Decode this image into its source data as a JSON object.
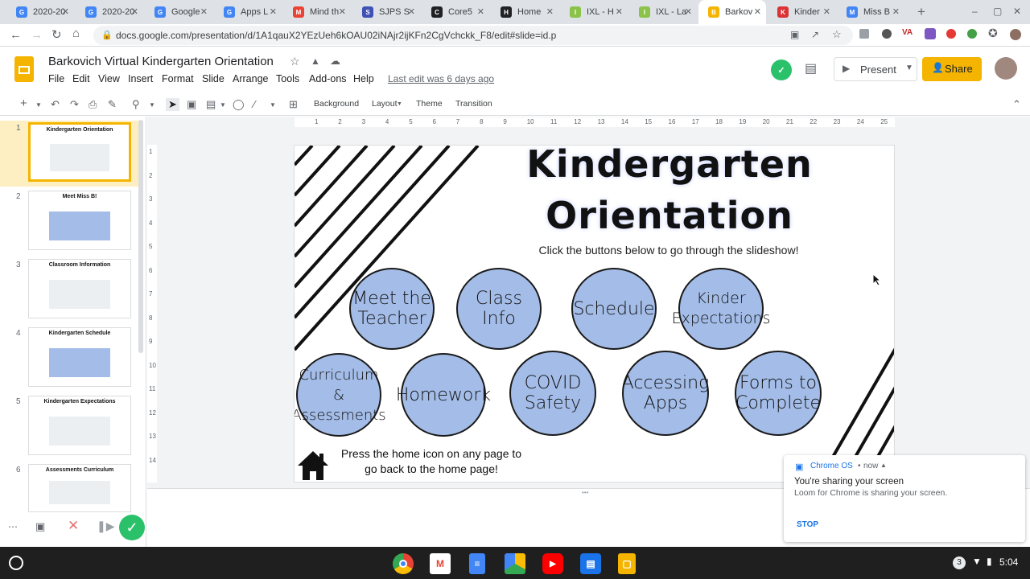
{
  "browser": {
    "tabs": [
      {
        "label": "2020-20",
        "color": "#4285f4",
        "glyph": "G"
      },
      {
        "label": "2020-20",
        "color": "#4285f4",
        "glyph": "G"
      },
      {
        "label": "Google",
        "color": "#4285f4",
        "glyph": "G"
      },
      {
        "label": "Apps L",
        "color": "#4285f4",
        "glyph": "G"
      },
      {
        "label": "Mind th",
        "color": "#ea4335",
        "glyph": "M"
      },
      {
        "label": "SJPS S",
        "color": "#3f51b5",
        "glyph": "S"
      },
      {
        "label": "Core5",
        "color": "#202124",
        "glyph": "C"
      },
      {
        "label": "Home",
        "color": "#202124",
        "glyph": "H"
      },
      {
        "label": "IXL - H",
        "color": "#8bc34a",
        "glyph": "I"
      },
      {
        "label": "IXL - La",
        "color": "#8bc34a",
        "glyph": "I"
      },
      {
        "label": "Barkov",
        "color": "#f4b400",
        "glyph": "B"
      },
      {
        "label": "Kinder",
        "color": "#db3236",
        "glyph": "K"
      },
      {
        "label": "Miss B",
        "color": "#4285f4",
        "glyph": "M"
      }
    ],
    "active_tab_index": 10,
    "url": "docs.google.com/presentation/d/1A1qauX2YEzUeh6kOAU02iNAjr2ijKFn2CgVchckk_F8/edit#slide=id.p"
  },
  "doc": {
    "title": "Barkovich Virtual Kindergarten Orientation",
    "menus": [
      "File",
      "Edit",
      "View",
      "Insert",
      "Format",
      "Slide",
      "Arrange",
      "Tools",
      "Add-ons",
      "Help"
    ],
    "last_edit": "Last edit was 6 days ago",
    "present_label": "Present",
    "share_label": "Share"
  },
  "toolbar": {
    "background": "Background",
    "layout": "Layout",
    "theme": "Theme",
    "transition": "Transition"
  },
  "filmstrip": [
    {
      "num": "1",
      "title": "Kindergarten Orientation"
    },
    {
      "num": "2",
      "title": "Meet Miss B!"
    },
    {
      "num": "3",
      "title": "Classroom Information"
    },
    {
      "num": "4",
      "title": "Kindergarten Schedule"
    },
    {
      "num": "5",
      "title": "Kindergarten Expectations"
    },
    {
      "num": "6",
      "title": "Assessments    Curriculum"
    }
  ],
  "ruler": {
    "top": [
      "1",
      "2",
      "3",
      "4",
      "5",
      "6",
      "7",
      "8",
      "9",
      "10",
      "11",
      "12",
      "13",
      "14",
      "15",
      "16",
      "17",
      "18",
      "19",
      "20",
      "21",
      "22",
      "23",
      "24",
      "25"
    ],
    "left": [
      "1",
      "2",
      "3",
      "4",
      "5",
      "6",
      "7",
      "8",
      "9",
      "10",
      "11",
      "12",
      "13",
      "14"
    ]
  },
  "slide": {
    "title_line1": "Kindergarten",
    "title_line2": "Orientation",
    "subtitle": "Click the buttons below to go through the slideshow!",
    "buttons": [
      {
        "l1": "Meet the",
        "l2": "Teacher"
      },
      {
        "l1": "Class Info",
        "l2": ""
      },
      {
        "l1": "Schedule",
        "l2": ""
      },
      {
        "l1": "Kinder",
        "l2": "Expectations"
      },
      {
        "l1": "Curriculum &",
        "l2": "Assessments"
      },
      {
        "l1": "Homework",
        "l2": ""
      },
      {
        "l1": "COVID",
        "l2": "Safety"
      },
      {
        "l1": "Accessing",
        "l2": "Apps"
      },
      {
        "l1": "Forms to",
        "l2": "Complete"
      }
    ],
    "home_line1": "Press the home icon on any page to",
    "home_line2": "go back to the home page!"
  },
  "notification": {
    "source": "Chrome OS",
    "time": "now",
    "title": "You're sharing your screen",
    "body": "Loom for Chrome is sharing your screen.",
    "action": "STOP"
  },
  "shelf": {
    "time": "5:04",
    "badge": "3"
  },
  "colors": {
    "accent_yellow": "#f4b400",
    "circle_fill": "#a4bde8",
    "loom_green": "#2bc16b"
  }
}
